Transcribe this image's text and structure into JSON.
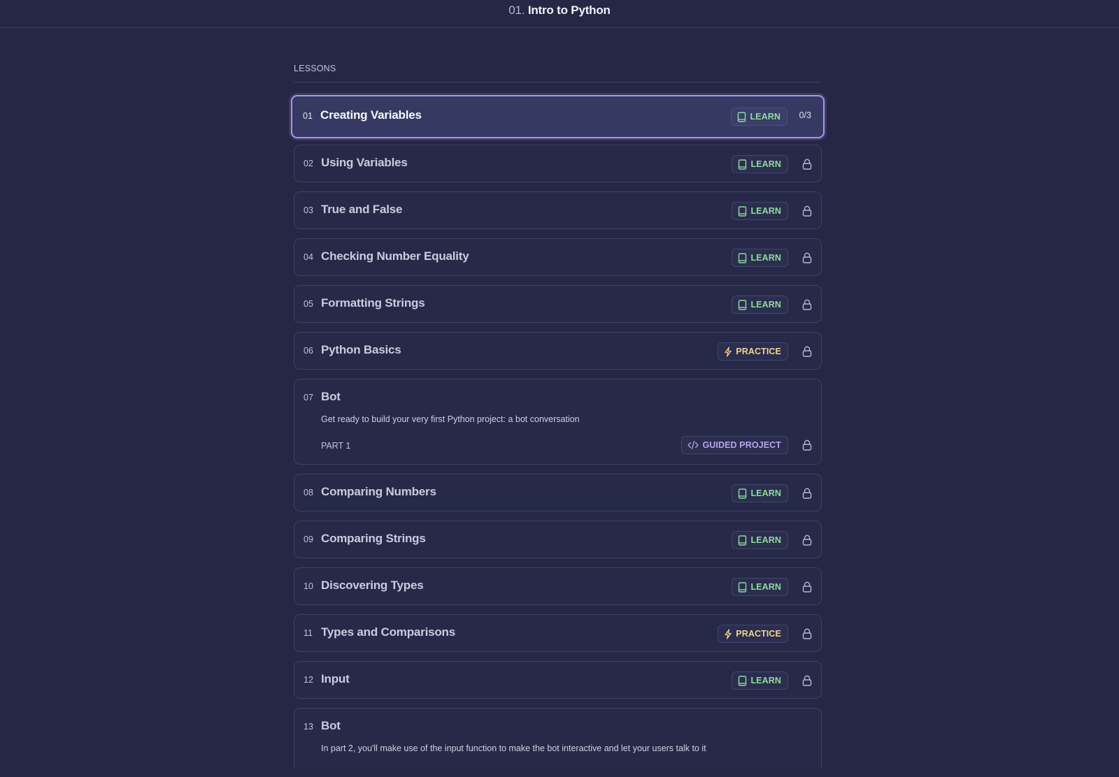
{
  "header": {
    "course_number": "01.",
    "course_title": "Intro to Python"
  },
  "lessons_label": "LESSONS",
  "colors": {
    "background": "#252744",
    "learn": "#8ddc9c",
    "practice": "#f2d28c",
    "guided": "#b5a6ef",
    "active_border": "#a896e8"
  },
  "lessons": [
    {
      "num": "01",
      "title": "Creating Variables",
      "badge": "LEARN",
      "status": "0/3",
      "active": true
    },
    {
      "num": "02",
      "title": "Using Variables",
      "badge": "LEARN",
      "status": "locked"
    },
    {
      "num": "03",
      "title": "True and False",
      "badge": "LEARN",
      "status": "locked"
    },
    {
      "num": "04",
      "title": "Checking Number Equality",
      "badge": "LEARN",
      "status": "locked"
    },
    {
      "num": "05",
      "title": "Formatting Strings",
      "badge": "LEARN",
      "status": "locked"
    },
    {
      "num": "06",
      "title": "Python Basics",
      "badge": "PRACTICE",
      "status": "locked"
    },
    {
      "num": "07",
      "title": "Bot",
      "description": "Get ready to build your very first Python project: a bot conversation",
      "part": "PART 1",
      "badge": "GUIDED PROJECT",
      "status": "locked"
    },
    {
      "num": "08",
      "title": "Comparing Numbers",
      "badge": "LEARN",
      "status": "locked"
    },
    {
      "num": "09",
      "title": "Comparing Strings",
      "badge": "LEARN",
      "status": "locked"
    },
    {
      "num": "10",
      "title": "Discovering Types",
      "badge": "LEARN",
      "status": "locked"
    },
    {
      "num": "11",
      "title": "Types and Comparisons",
      "badge": "PRACTICE",
      "status": "locked"
    },
    {
      "num": "12",
      "title": "Input",
      "badge": "LEARN",
      "status": "locked"
    },
    {
      "num": "13",
      "title": "Bot",
      "description": "In part 2, you'll make use of the input function to make the bot interactive and let your users talk to it"
    }
  ]
}
